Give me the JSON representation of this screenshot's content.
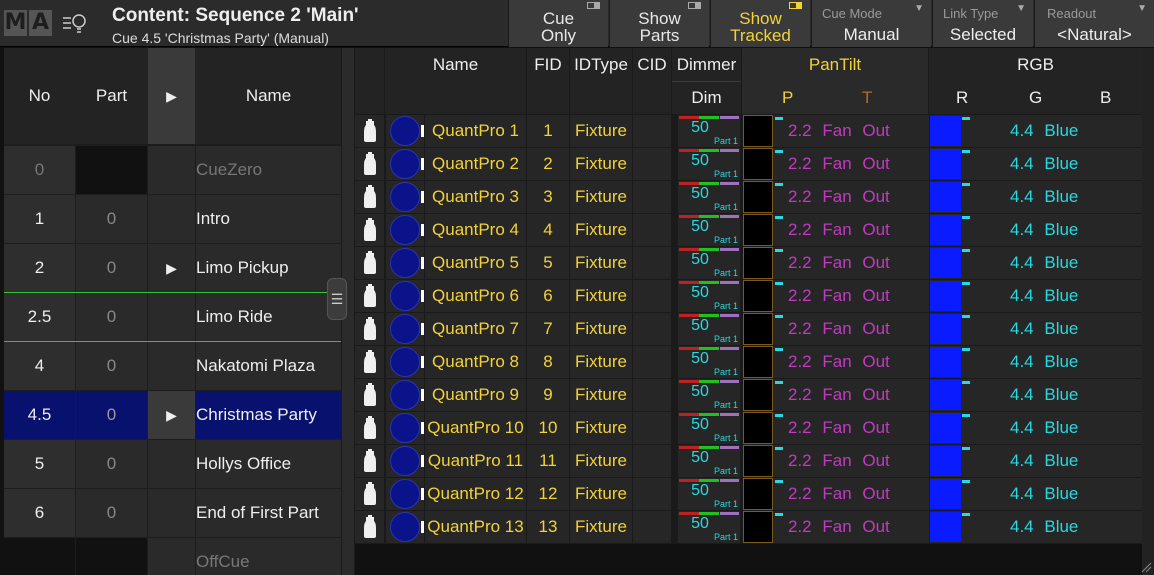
{
  "app": {
    "logo_letters": [
      "M",
      "A"
    ],
    "title": "Content: Sequence 2 'Main'",
    "subtitle": "Cue 4.5 'Christmas Party' (Manual)"
  },
  "toolbar": {
    "cue_only": {
      "line1": "Cue",
      "line2": "Only"
    },
    "show_parts": {
      "line1": "Show",
      "line2": "Parts"
    },
    "show_tracked": {
      "line1": "Show",
      "line2": "Tracked"
    },
    "cue_mode": {
      "caption": "Cue Mode",
      "value": "Manual"
    },
    "link_type": {
      "caption": "Link Type",
      "value": "Selected"
    },
    "readout": {
      "caption": "Readout",
      "value": "<Natural>"
    },
    "accent_color": "#f2d23a"
  },
  "sequence": {
    "headers": {
      "no": "No",
      "part": "Part",
      "play": "▶",
      "name": "Name"
    },
    "rows": [
      {
        "no": "0",
        "part": "",
        "play": "",
        "name": "CueZero",
        "style": "dim"
      },
      {
        "no": "1",
        "part": "0",
        "play": "",
        "name": "Intro",
        "style": ""
      },
      {
        "no": "2",
        "part": "0",
        "play": "▶",
        "name": "Limo Pickup",
        "style": ""
      },
      {
        "no": "2.5",
        "part": "0",
        "play": "",
        "name": "Limo Ride",
        "style": ""
      },
      {
        "no": "4",
        "part": "0",
        "play": "",
        "name": "Nakatomi Plaza",
        "style": ""
      },
      {
        "no": "4.5",
        "part": "0",
        "play": "▶",
        "name": "Christmas Party",
        "style": "sel"
      },
      {
        "no": "5",
        "part": "0",
        "play": "",
        "name": "Hollys Office",
        "style": ""
      },
      {
        "no": "6",
        "part": "0",
        "play": "",
        "name": "End of First Part",
        "style": ""
      },
      {
        "no": "",
        "part": "",
        "play": "",
        "name": "OffCue",
        "style": "dim"
      }
    ]
  },
  "fixture_sheet": {
    "headers": {
      "name": "Name",
      "fid": "FID",
      "idtype": "IDType",
      "cid": "CID",
      "dimmer": "Dimmer",
      "dim": "Dim",
      "pantilt": "PanTilt",
      "p": "P",
      "t": "T",
      "rgb": "RGB",
      "r": "R",
      "g": "G",
      "b": "B"
    },
    "rows": [
      {
        "name": "QuantPro 1",
        "fid": "1",
        "idtype": "Fixture",
        "dim": "50",
        "dim_part": "Part 1",
        "pantilt": "2.2 Fan Out",
        "rgb": "4.4 Blue"
      },
      {
        "name": "QuantPro 2",
        "fid": "2",
        "idtype": "Fixture",
        "dim": "50",
        "dim_part": "Part 1",
        "pantilt": "2.2 Fan Out",
        "rgb": "4.4 Blue"
      },
      {
        "name": "QuantPro 3",
        "fid": "3",
        "idtype": "Fixture",
        "dim": "50",
        "dim_part": "Part 1",
        "pantilt": "2.2 Fan Out",
        "rgb": "4.4 Blue"
      },
      {
        "name": "QuantPro 4",
        "fid": "4",
        "idtype": "Fixture",
        "dim": "50",
        "dim_part": "Part 1",
        "pantilt": "2.2 Fan Out",
        "rgb": "4.4 Blue"
      },
      {
        "name": "QuantPro 5",
        "fid": "5",
        "idtype": "Fixture",
        "dim": "50",
        "dim_part": "Part 1",
        "pantilt": "2.2 Fan Out",
        "rgb": "4.4 Blue"
      },
      {
        "name": "QuantPro 6",
        "fid": "6",
        "idtype": "Fixture",
        "dim": "50",
        "dim_part": "Part 1",
        "pantilt": "2.2 Fan Out",
        "rgb": "4.4 Blue"
      },
      {
        "name": "QuantPro 7",
        "fid": "7",
        "idtype": "Fixture",
        "dim": "50",
        "dim_part": "Part 1",
        "pantilt": "2.2 Fan Out",
        "rgb": "4.4 Blue"
      },
      {
        "name": "QuantPro 8",
        "fid": "8",
        "idtype": "Fixture",
        "dim": "50",
        "dim_part": "Part 1",
        "pantilt": "2.2 Fan Out",
        "rgb": "4.4 Blue"
      },
      {
        "name": "QuantPro 9",
        "fid": "9",
        "idtype": "Fixture",
        "dim": "50",
        "dim_part": "Part 1",
        "pantilt": "2.2 Fan Out",
        "rgb": "4.4 Blue"
      },
      {
        "name": "QuantPro 10",
        "fid": "10",
        "idtype": "Fixture",
        "dim": "50",
        "dim_part": "Part 1",
        "pantilt": "2.2 Fan Out",
        "rgb": "4.4 Blue"
      },
      {
        "name": "QuantPro 11",
        "fid": "11",
        "idtype": "Fixture",
        "dim": "50",
        "dim_part": "Part 1",
        "pantilt": "2.2 Fan Out",
        "rgb": "4.4 Blue"
      },
      {
        "name": "QuantPro 12",
        "fid": "12",
        "idtype": "Fixture",
        "dim": "50",
        "dim_part": "Part 1",
        "pantilt": "2.2 Fan Out",
        "rgb": "4.4 Blue"
      },
      {
        "name": "QuantPro 13",
        "fid": "13",
        "idtype": "Fixture",
        "dim": "50",
        "dim_part": "Part 1",
        "pantilt": "2.2 Fan Out",
        "rgb": "4.4 Blue"
      }
    ],
    "colors": {
      "value_yellow": "#f2d23a",
      "preset_magenta": "#c23ac2",
      "value_cyan": "#29d8e0",
      "rgb_swatch": "#0a1cff",
      "selected_cue": "#08116e"
    }
  }
}
